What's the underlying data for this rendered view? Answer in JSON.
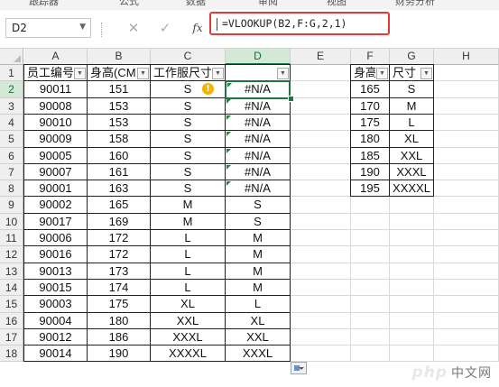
{
  "menu_partial": [
    "跟踪器",
    "公式",
    "数据",
    "审阅",
    "视图",
    "财务分析"
  ],
  "name_box": {
    "value": "D2"
  },
  "formula_bar": {
    "cancel_icon": "close-icon",
    "enter_icon": "check-icon",
    "fx_label": "fx",
    "formula": "=VLOOKUP(B2,F:G,2,1)"
  },
  "columns": [
    "A",
    "B",
    "C",
    "D",
    "E",
    "F",
    "G",
    "H"
  ],
  "rows": [
    1,
    2,
    3,
    4,
    5,
    6,
    7,
    8,
    9,
    10,
    11,
    12,
    13,
    14,
    15,
    16,
    17,
    18
  ],
  "selected": {
    "column": "D",
    "row": 2
  },
  "headers": {
    "A": "员工编号",
    "B": "身高(CM)",
    "C": "工作服尺寸",
    "D": "",
    "F": "身高",
    "G": "尺寸"
  },
  "main_table": [
    {
      "id": "90011",
      "height": "151",
      "size": "S",
      "result": "#N/A"
    },
    {
      "id": "90008",
      "height": "153",
      "size": "S",
      "result": "#N/A"
    },
    {
      "id": "90010",
      "height": "153",
      "size": "S",
      "result": "#N/A"
    },
    {
      "id": "90009",
      "height": "158",
      "size": "S",
      "result": "#N/A"
    },
    {
      "id": "90005",
      "height": "160",
      "size": "S",
      "result": "#N/A"
    },
    {
      "id": "90007",
      "height": "161",
      "size": "S",
      "result": "#N/A"
    },
    {
      "id": "90001",
      "height": "163",
      "size": "S",
      "result": "#N/A"
    },
    {
      "id": "90002",
      "height": "165",
      "size": "M",
      "result": "S"
    },
    {
      "id": "90017",
      "height": "169",
      "size": "M",
      "result": "S"
    },
    {
      "id": "90006",
      "height": "172",
      "size": "L",
      "result": "M"
    },
    {
      "id": "90016",
      "height": "172",
      "size": "L",
      "result": "M"
    },
    {
      "id": "90013",
      "height": "173",
      "size": "L",
      "result": "M"
    },
    {
      "id": "90015",
      "height": "174",
      "size": "L",
      "result": "M"
    },
    {
      "id": "90003",
      "height": "175",
      "size": "XL",
      "result": "L"
    },
    {
      "id": "90004",
      "height": "180",
      "size": "XXL",
      "result": "XL"
    },
    {
      "id": "90012",
      "height": "186",
      "size": "XXXL",
      "result": "XXL"
    },
    {
      "id": "90014",
      "height": "190",
      "size": "XXXXL",
      "result": "XXXL"
    }
  ],
  "lookup_table": [
    {
      "height": "165",
      "size": "S"
    },
    {
      "height": "170",
      "size": "M"
    },
    {
      "height": "175",
      "size": "L"
    },
    {
      "height": "180",
      "size": "XL"
    },
    {
      "height": "185",
      "size": "XXL"
    },
    {
      "height": "190",
      "size": "XXXL"
    },
    {
      "height": "195",
      "size": "XXXXL"
    }
  ],
  "warning_icon": {
    "name": "warning-icon",
    "glyph": "!"
  },
  "paste_options_icon": "paste-options-icon",
  "watermark": {
    "logo": "php",
    "text": "中文网"
  },
  "colors": {
    "accent": "#217346",
    "formula_highlight": "#e03c3c",
    "error_flag": "#1f8a3b",
    "warning": "#f3b400"
  }
}
